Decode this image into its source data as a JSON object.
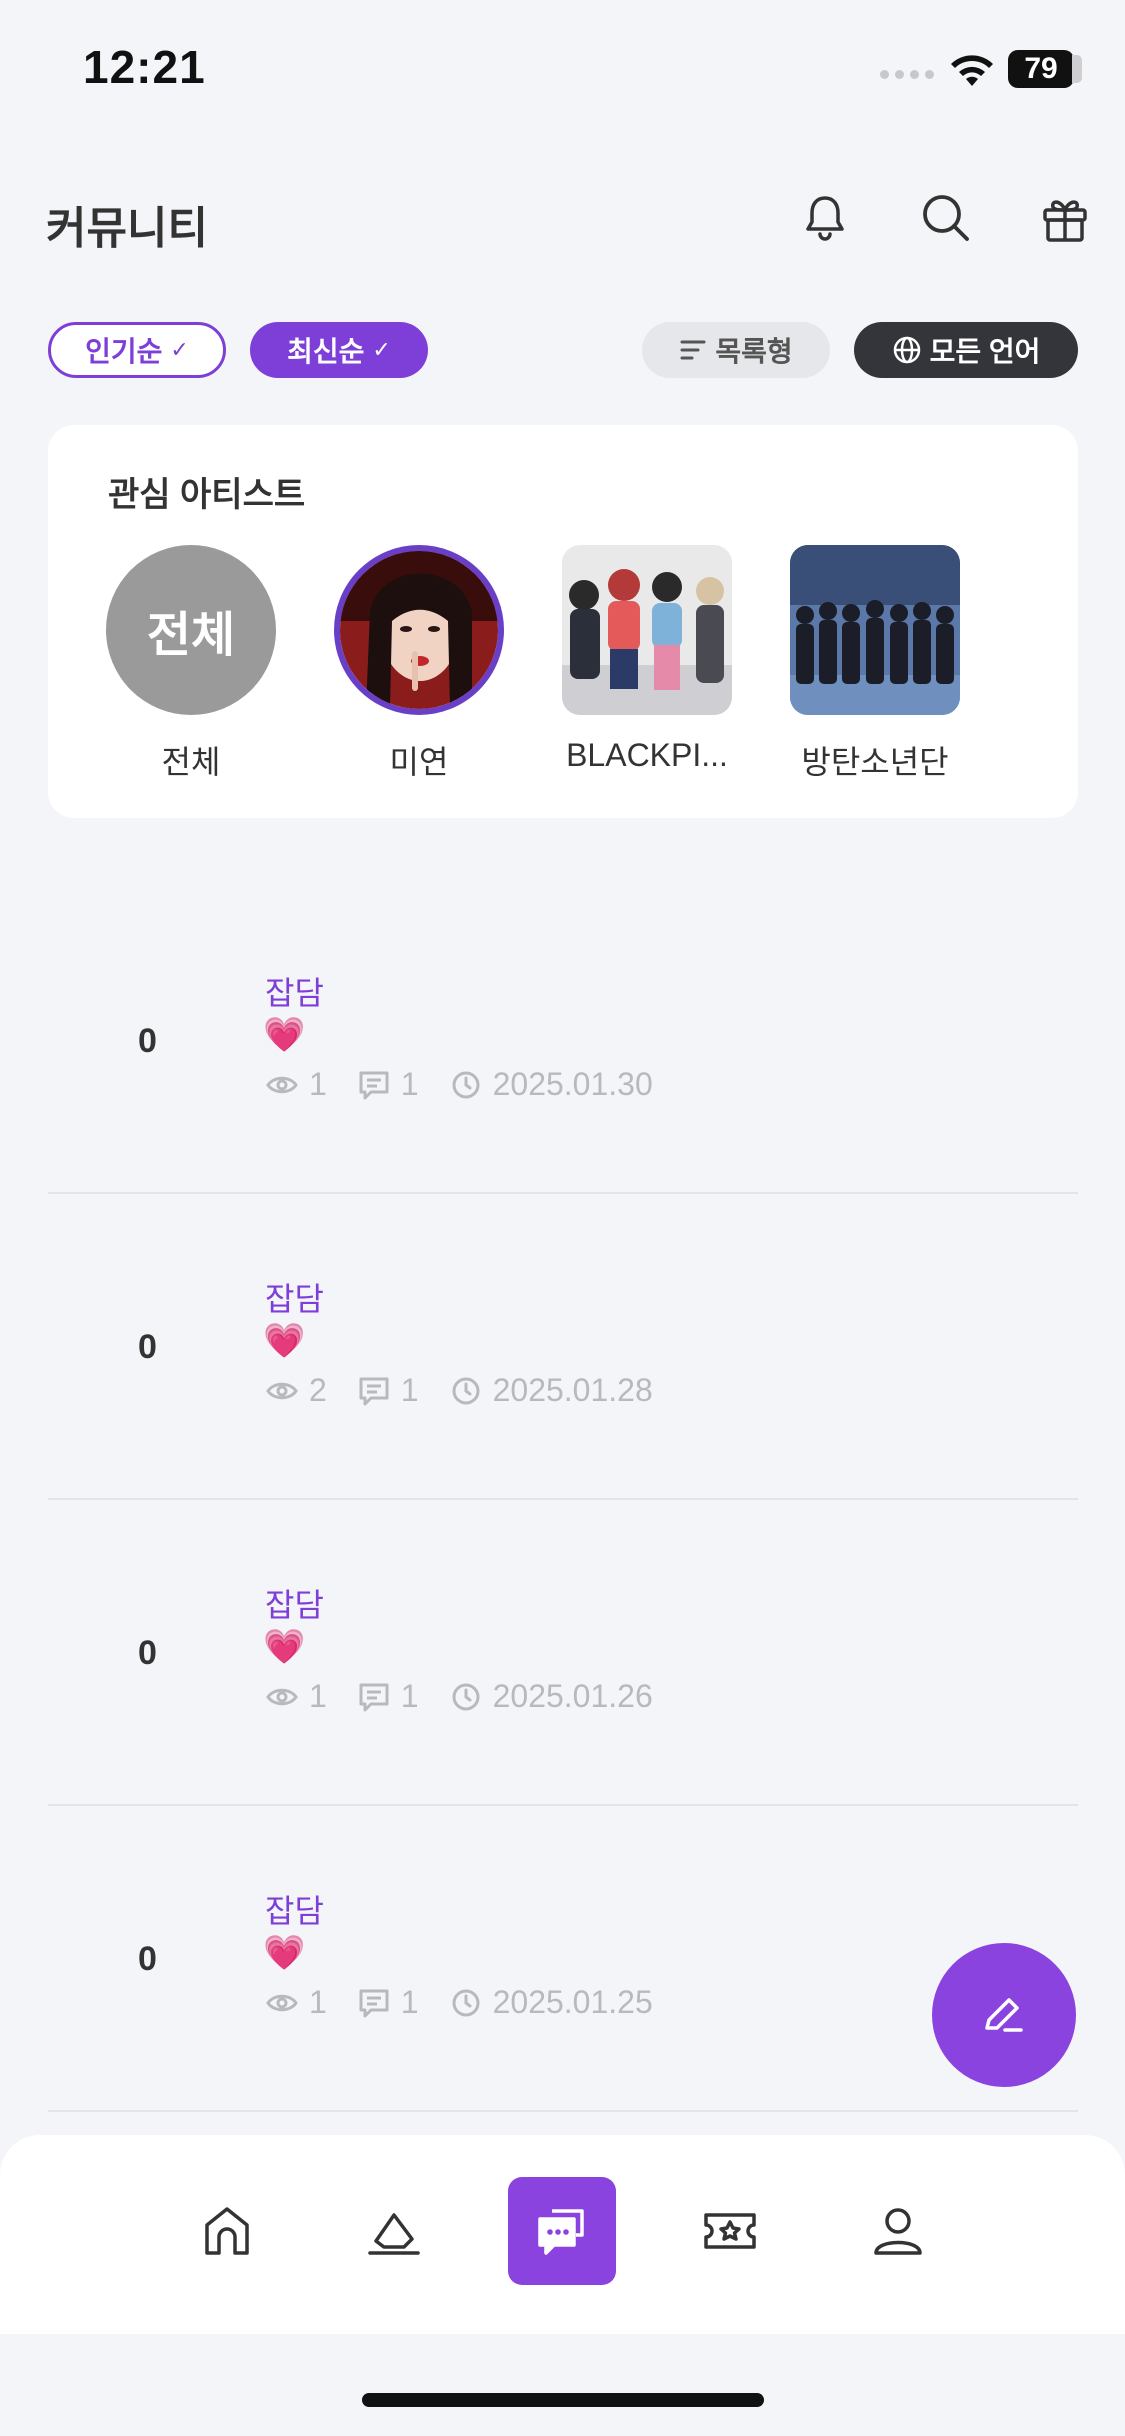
{
  "status_bar": {
    "time": "12:21",
    "battery": "79"
  },
  "header": {
    "title": "커뮤니티"
  },
  "filters": {
    "popular": "인기순",
    "latest": "최신순",
    "list_view": "목록형",
    "language": "모든 언어"
  },
  "artists": {
    "title": "관심 아티스트",
    "all_thumb_label": "전체",
    "items": [
      {
        "name": "전체"
      },
      {
        "name": "미연"
      },
      {
        "name": "BLACKPI..."
      },
      {
        "name": "방탄소년단"
      }
    ]
  },
  "posts": [
    {
      "likes": "0",
      "category": "잡담",
      "emoji": "💗",
      "views": "1",
      "comments": "1",
      "date": "2025.01.30"
    },
    {
      "likes": "0",
      "category": "잡담",
      "emoji": "💗",
      "views": "2",
      "comments": "1",
      "date": "2025.01.28"
    },
    {
      "likes": "0",
      "category": "잡담",
      "emoji": "💗",
      "views": "1",
      "comments": "1",
      "date": "2025.01.26"
    },
    {
      "likes": "0",
      "category": "잡담",
      "emoji": "💗",
      "views": "1",
      "comments": "1",
      "date": "2025.01.25"
    }
  ],
  "colors": {
    "accent": "#7e3fd8",
    "fab": "#8b43e0",
    "background": "#f4f5f8"
  },
  "tabbar": {
    "icons": [
      "home-icon",
      "eraser-icon",
      "chat-icon",
      "ticket-icon",
      "profile-icon"
    ],
    "active_index": 2
  }
}
